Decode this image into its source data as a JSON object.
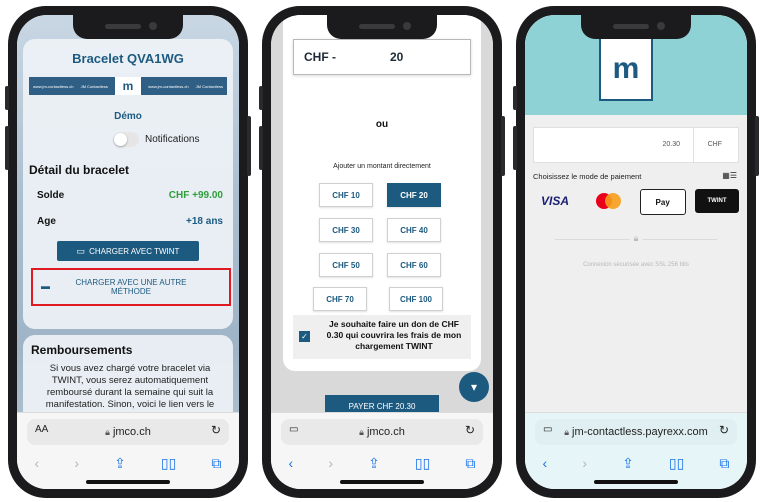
{
  "phone1": {
    "bracelet_title": "Bracelet QVA1WG",
    "logo_left_text": "www.jm-contactless.ch",
    "logo_brand_text": "JM Contactless",
    "demo": "Démo",
    "notifications_label": "Notifications",
    "detail_heading": "Détail du bracelet",
    "balance_label": "Solde",
    "balance_value": "CHF +99.00",
    "balance_color": "#2e9e3a",
    "age_label": "Age",
    "age_value": "+18 ans",
    "twint_button": "CHARGER AVEC TWINT",
    "other_method_line1": "CHARGER AVEC UNE AUTRE",
    "other_method_line2": "MÉTHODE",
    "refund_heading": "Remboursements",
    "refund_text": "Si vous avez chargé votre bracelet via TWINT, vous serez automatiquement remboursé durant la semaine qui suit la manifestation. Sinon, voici le lien vers le formulaire de remboursement :",
    "url_text_size": "AA",
    "url": "jmco.ch"
  },
  "phone2": {
    "currency": "CHF -",
    "amount": "20",
    "or_label": "ou",
    "direct_label": "Ajouter un montant directement",
    "options": [
      {
        "label": "CHF 10",
        "selected": false
      },
      {
        "label": "CHF 20",
        "selected": true
      },
      {
        "label": "CHF 30",
        "selected": false
      },
      {
        "label": "CHF 40",
        "selected": false
      },
      {
        "label": "CHF 50",
        "selected": false
      },
      {
        "label": "CHF 60",
        "selected": false
      },
      {
        "label": "CHF 70",
        "selected": false
      },
      {
        "label": "CHF 100",
        "selected": false
      }
    ],
    "donation_text": "Je souhaite faire un don de CHF 0.30 qui couvrira les frais de mon chargement TWINT",
    "donation_checked": true,
    "pay_button": "PAYER CHF 20.30",
    "url": "jmco.ch"
  },
  "phone3": {
    "amount": "20.30",
    "currency": "CHF",
    "choose_label": "Choisissez le mode de paiement",
    "methods": [
      "VISA",
      "Mastercard",
      "Pay",
      "TWINT"
    ],
    "secure_text": "Connexion sécurisée avec SSL 256 bits",
    "url": "jm-contactless.payrexx.com"
  },
  "accent_color": "#1d5a80",
  "highlight_color": "#e01a22"
}
